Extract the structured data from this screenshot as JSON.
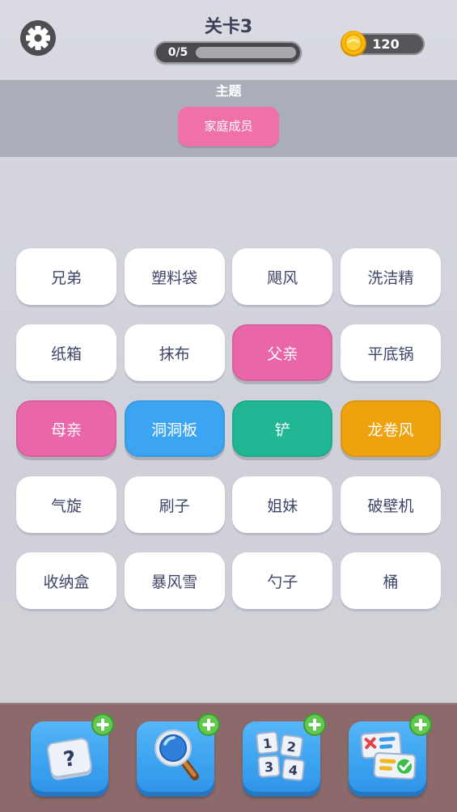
{
  "header": {
    "settings_icon": "gear-icon",
    "title": "关卡3",
    "progress_label": "0/5",
    "progress": {
      "found": 0,
      "total": 5
    },
    "coin_icon": "coin-icon",
    "coins": "120"
  },
  "theme": {
    "label": "主题",
    "name": "家庭成员"
  },
  "words": [
    {
      "text": "兄弟",
      "color": "#ffffff"
    },
    {
      "text": "塑料袋",
      "color": "#ffffff"
    },
    {
      "text": "飓风",
      "color": "#ffffff"
    },
    {
      "text": "洗洁精",
      "color": "#ffffff"
    },
    {
      "text": "纸箱",
      "color": "#ffffff"
    },
    {
      "text": "抹布",
      "color": "#ffffff"
    },
    {
      "text": "父亲",
      "color": "#e966ab"
    },
    {
      "text": "平底锅",
      "color": "#ffffff"
    },
    {
      "text": "母亲",
      "color": "#e966ab"
    },
    {
      "text": "洞洞板",
      "color": "#3ba5f3"
    },
    {
      "text": "铲",
      "color": "#21b795"
    },
    {
      "text": "龙卷风",
      "color": "#eea20e"
    },
    {
      "text": "气旋",
      "color": "#ffffff"
    },
    {
      "text": "刷子",
      "color": "#ffffff"
    },
    {
      "text": "姐妹",
      "color": "#ffffff"
    },
    {
      "text": "破壁机",
      "color": "#ffffff"
    },
    {
      "text": "收纳盒",
      "color": "#ffffff"
    },
    {
      "text": "暴风雪",
      "color": "#ffffff"
    },
    {
      "text": "勺子",
      "color": "#ffffff"
    },
    {
      "text": "桶",
      "color": "#ffffff"
    }
  ],
  "tools": [
    {
      "icon": "question-card-icon",
      "glyph": "?",
      "badge_icon": "plus-icon"
    },
    {
      "icon": "magnifier-icon",
      "badge_icon": "plus-icon"
    },
    {
      "icon": "number-cards-icon",
      "digits": [
        "1",
        "2",
        "3",
        "4"
      ],
      "badge_icon": "plus-icon"
    },
    {
      "icon": "checklist-icon",
      "badge_icon": "plus-icon"
    }
  ],
  "colors": {
    "header_text": "#3b3f57",
    "tile_white": "#ffffff",
    "tile_text": "#3d4669",
    "accent_pink": "#f070a8",
    "tool_blue": "#3ba3f0",
    "badge_green": "#62c94f",
    "bottom_bar": "#8c6a6b",
    "band_gray": "#aaaeb9"
  }
}
